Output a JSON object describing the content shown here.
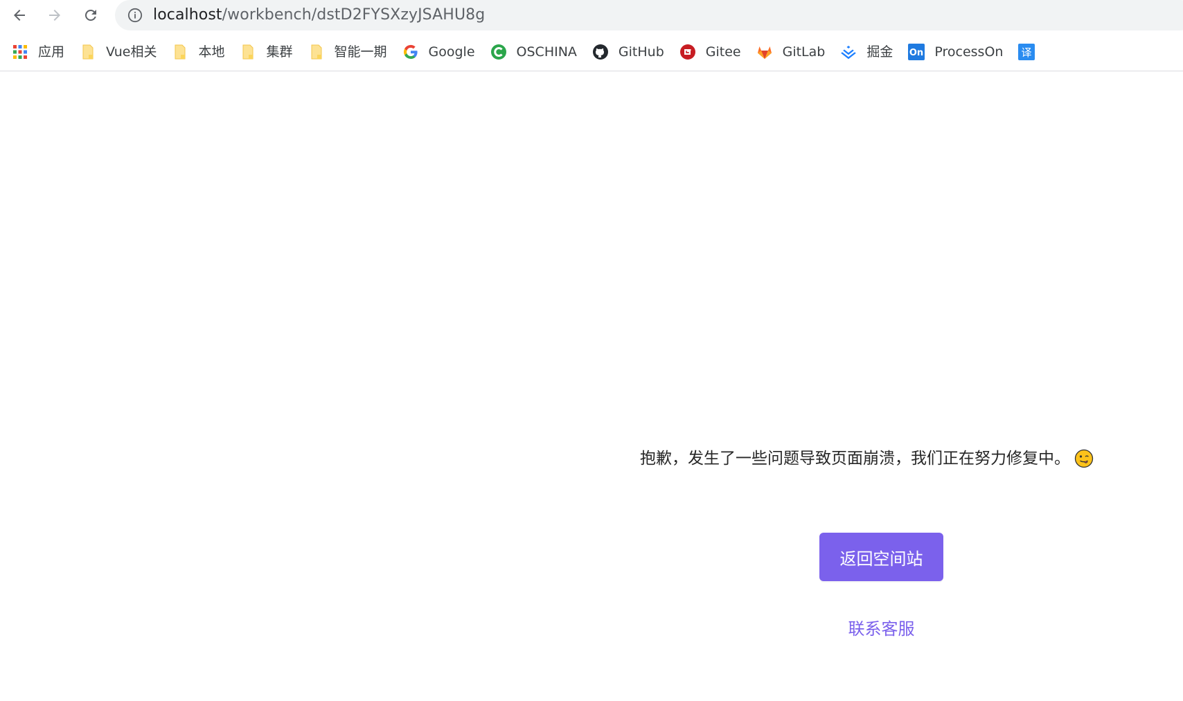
{
  "browser": {
    "url_host": "localhost",
    "url_path": "/workbench/dstD2FYSXzyJSAHU8g"
  },
  "bookmarks": [
    {
      "label": "应用",
      "icon": "apps-grid-icon"
    },
    {
      "label": "Vue相关",
      "icon": "folder-icon"
    },
    {
      "label": "本地",
      "icon": "folder-icon"
    },
    {
      "label": "集群",
      "icon": "folder-icon"
    },
    {
      "label": "智能一期",
      "icon": "folder-icon"
    },
    {
      "label": "Google",
      "icon": "google-icon"
    },
    {
      "label": "OSCHINA",
      "icon": "oschina-icon"
    },
    {
      "label": "GitHub",
      "icon": "github-icon"
    },
    {
      "label": "Gitee",
      "icon": "gitee-icon"
    },
    {
      "label": "GitLab",
      "icon": "gitlab-icon"
    },
    {
      "label": "掘金",
      "icon": "juejin-icon"
    },
    {
      "label": "ProcessOn",
      "icon": "processon-icon"
    },
    {
      "label": "",
      "icon": "translate-icon",
      "icon_text": "译"
    }
  ],
  "processon_icon_text": "On",
  "page": {
    "error_message": "抱歉，发生了一些问题导致页面崩溃，我们正在努力修复中。",
    "return_button_label": "返回空间站",
    "contact_link_label": "联系客服"
  },
  "colors": {
    "accent": "#7b61ec",
    "omnibox_bg": "#f1f3f4"
  }
}
